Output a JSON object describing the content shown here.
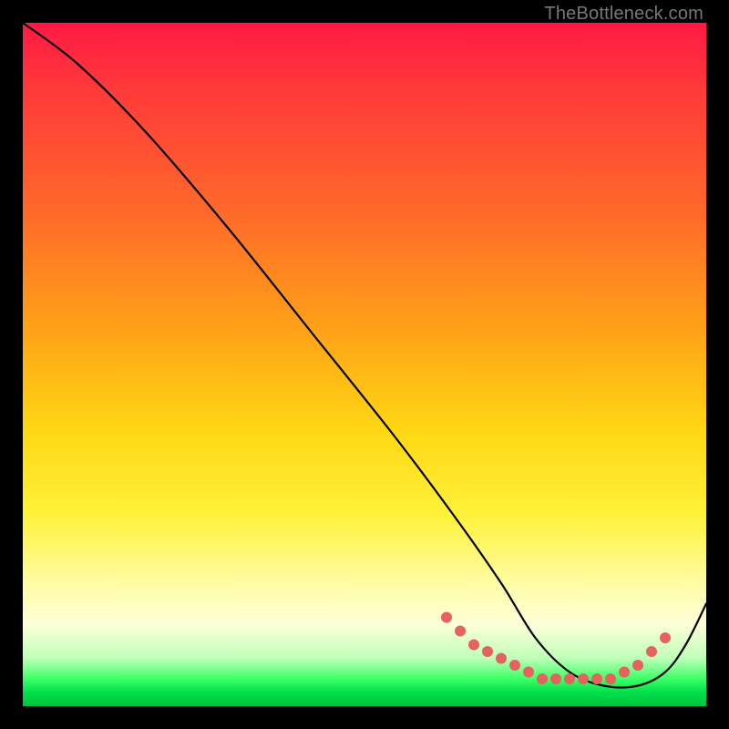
{
  "attribution": "TheBottleneck.com",
  "chart_data": {
    "type": "line",
    "title": "",
    "xlabel": "",
    "ylabel": "",
    "xlim": [
      0,
      100
    ],
    "ylim": [
      0,
      100
    ],
    "series": [
      {
        "name": "curve",
        "x": [
          0,
          8,
          18,
          30,
          42,
          54,
          63,
          70,
          75,
          80,
          85,
          90,
          94,
          97,
          100
        ],
        "y": [
          100,
          94,
          84,
          70,
          55,
          40,
          28,
          18,
          10,
          5,
          3,
          3,
          5,
          9,
          15
        ]
      }
    ],
    "markers": {
      "name": "highlight-dots",
      "color": "#e6625f",
      "x": [
        62,
        64,
        66,
        68,
        70,
        72,
        74,
        76,
        78,
        80,
        82,
        84,
        86,
        88,
        90,
        92,
        94
      ],
      "y": [
        13,
        11,
        9,
        8,
        7,
        6,
        5,
        4,
        4,
        4,
        4,
        4,
        4,
        5,
        6,
        8,
        10
      ]
    }
  }
}
